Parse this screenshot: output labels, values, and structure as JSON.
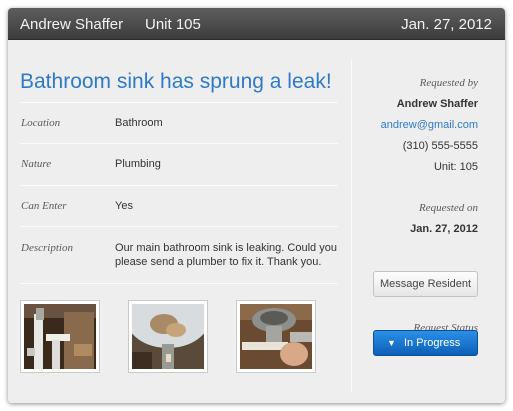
{
  "header": {
    "resident_name": "Andrew Shaffer",
    "unit": "Unit 105",
    "date": "Jan. 27, 2012"
  },
  "request": {
    "title": "Bathroom sink has sprung a leak!",
    "fields": [
      {
        "label": "Location",
        "value": "Bathroom"
      },
      {
        "label": "Nature",
        "value": "Plumbing"
      },
      {
        "label": "Can Enter",
        "value": "Yes"
      },
      {
        "label": "Description",
        "value": "Our main bathroom sink is leaking. Could you please send a plumber to fix it.  Thank you."
      }
    ],
    "photos": [
      "pipe-under-sink-photo",
      "sink-bowl-underside-photo",
      "drain-fitting-photo"
    ]
  },
  "sidebar": {
    "requested_by_label": "Requested by",
    "name": "Andrew Shaffer",
    "email": "andrew@gmail.com",
    "phone": "(310) 555-5555",
    "unit": "Unit: 105",
    "requested_on_label": "Requested on",
    "requested_on": "Jan. 27, 2012",
    "message_button": "Message Resident",
    "status_label": "Request Status",
    "status_value": "In Progress",
    "status_icon": "caret-down-icon"
  },
  "colors": {
    "accent": "#2f7ac8",
    "header_bg": "#4a4a4a",
    "status_button": "#1a74d2"
  }
}
